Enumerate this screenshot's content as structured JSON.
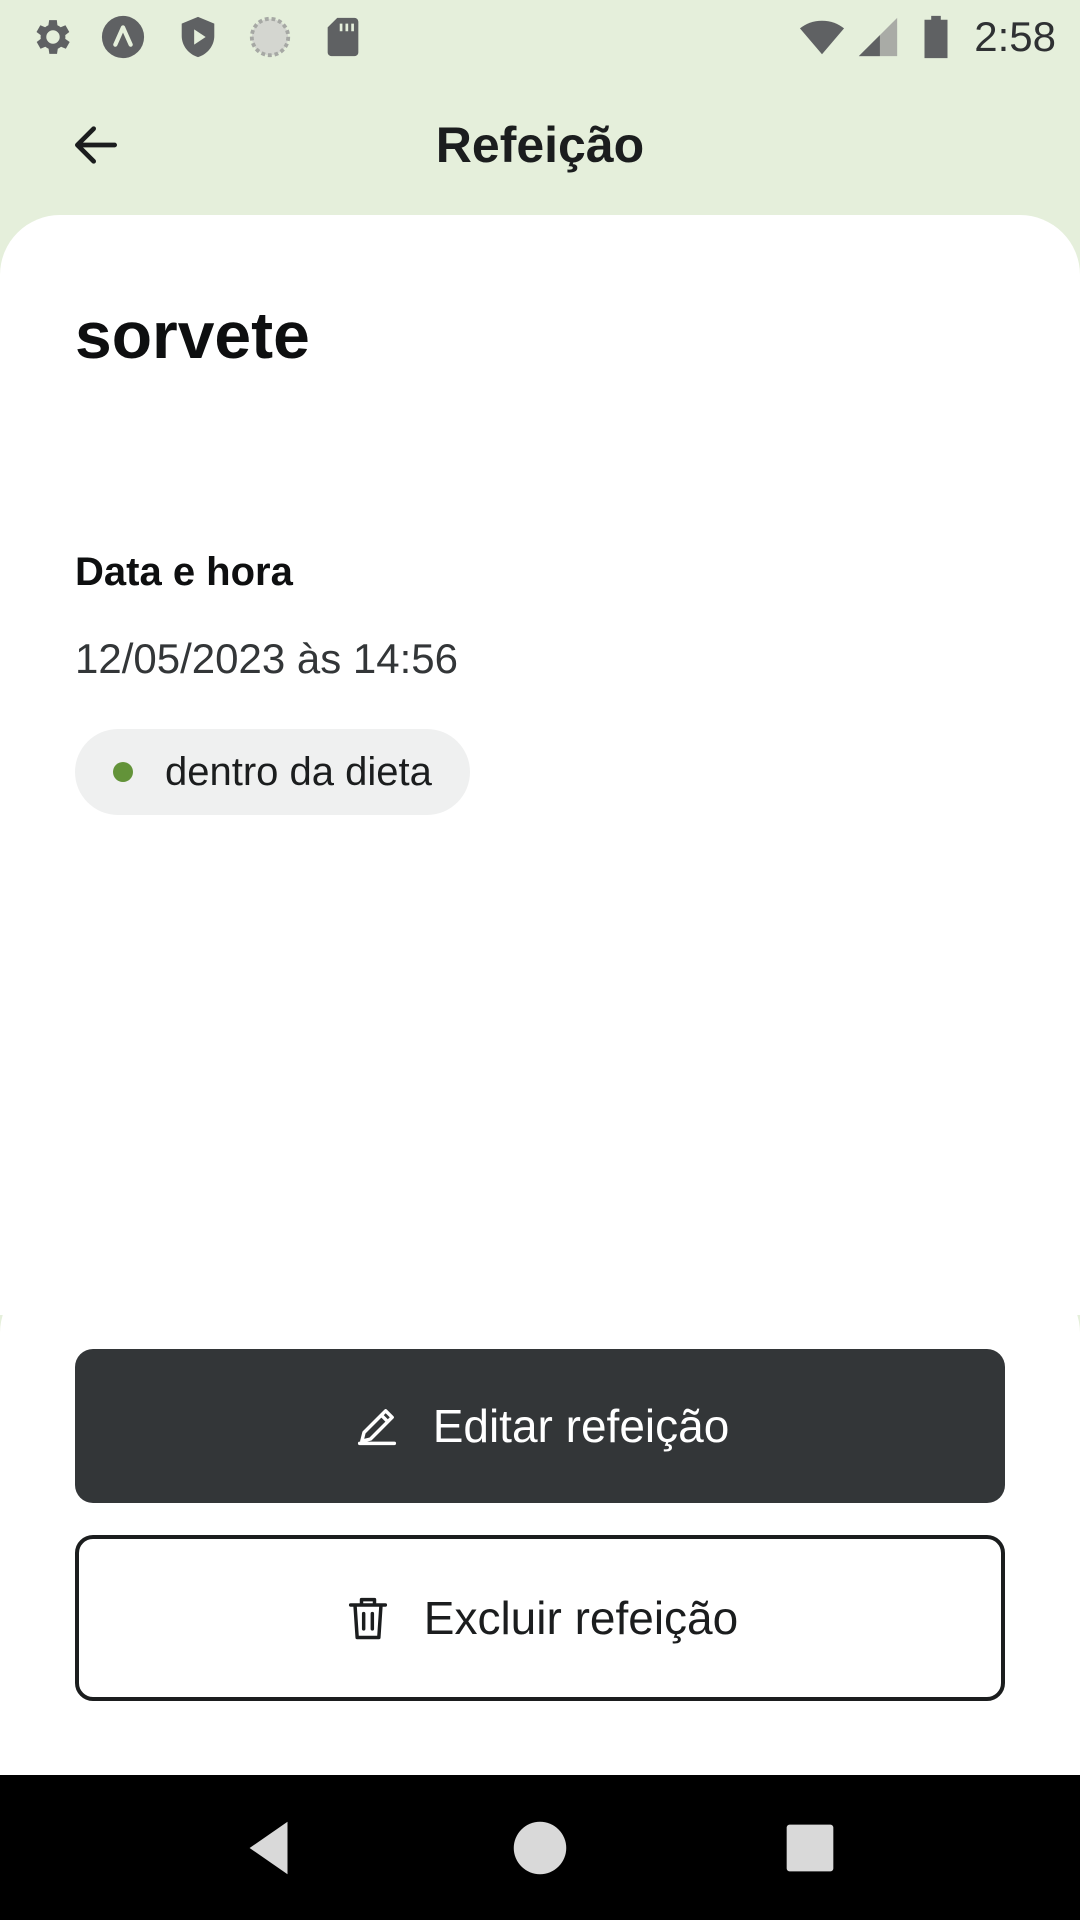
{
  "status_bar": {
    "time": "2:58",
    "icons": [
      "gear-icon",
      "app-a-icon",
      "shield-play-icon",
      "loading-circle-icon",
      "sd-card-icon",
      "wifi-icon",
      "signal-icon",
      "battery-icon"
    ]
  },
  "header": {
    "title": "Refeição",
    "back_icon": "arrow-left-icon"
  },
  "meal": {
    "name": "sorvete",
    "datetime_label": "Data e hora",
    "datetime_value": "12/05/2023 às 14:56",
    "status": {
      "label": "dentro da dieta",
      "dot_color": "#639339"
    }
  },
  "actions": {
    "edit_label": "Editar refeição",
    "edit_icon": "pencil-icon",
    "delete_label": "Excluir refeição",
    "delete_icon": "trash-icon"
  },
  "navigation": {
    "back": "nav-back-icon",
    "home": "nav-home-icon",
    "recents": "nav-recents-icon"
  },
  "colors": {
    "background": "#e5efdb",
    "surface": "#ffffff",
    "primary_button": "#333638",
    "chip": "#eff0f0"
  }
}
